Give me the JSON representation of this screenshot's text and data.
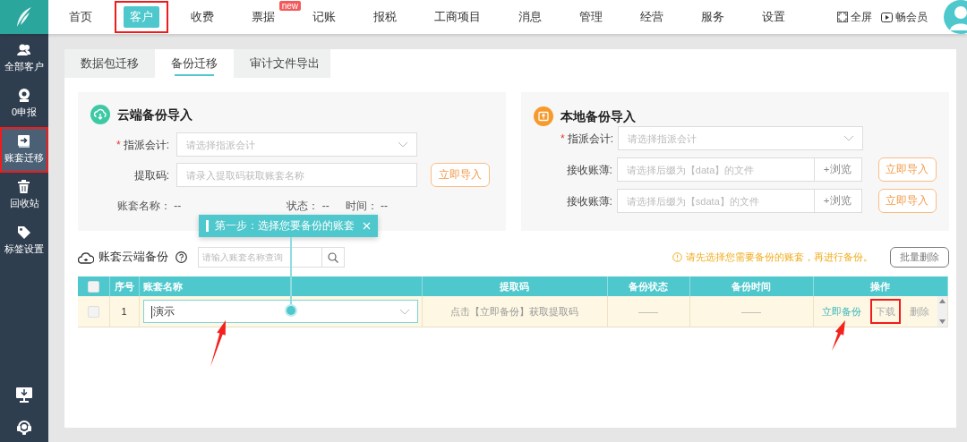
{
  "nav": [
    {
      "label": "首页",
      "selected": false,
      "annotated": false
    },
    {
      "label": "客户",
      "selected": true,
      "annotated": true
    },
    {
      "label": "收费",
      "selected": false,
      "annotated": false
    },
    {
      "label": "票据",
      "selected": false,
      "annotated": false,
      "badge": "new"
    },
    {
      "label": "记账",
      "selected": false,
      "annotated": false
    },
    {
      "label": "报税",
      "selected": false,
      "annotated": false
    },
    {
      "label": "工商项目",
      "selected": false,
      "annotated": false
    },
    {
      "label": "消息",
      "selected": false,
      "annotated": false
    },
    {
      "label": "管理",
      "selected": false,
      "annotated": false
    },
    {
      "label": "经营",
      "selected": false,
      "annotated": false
    },
    {
      "label": "服务",
      "selected": false,
      "annotated": false
    },
    {
      "label": "设置",
      "selected": false,
      "annotated": false
    }
  ],
  "header_actions": [
    {
      "kind": "fullscreen",
      "label": "全屏"
    },
    {
      "kind": "vip",
      "label": "畅会员"
    }
  ],
  "sidebar": {
    "items": [
      {
        "kind": "users",
        "label": "全部客户",
        "selected": false,
        "annotated": false
      },
      {
        "kind": "zero",
        "label": "0申报",
        "selected": false,
        "annotated": false
      },
      {
        "kind": "transfer",
        "label": "账套迁移",
        "selected": true,
        "annotated": true
      },
      {
        "kind": "trash",
        "label": "回收站",
        "selected": false,
        "annotated": false
      },
      {
        "kind": "tag",
        "label": "标签设置",
        "selected": false,
        "annotated": false
      }
    ]
  },
  "tabs": [
    {
      "label": "数据包迁移",
      "selected": false
    },
    {
      "label": "备份迁移",
      "selected": true
    },
    {
      "label": "审计文件导出",
      "selected": false
    }
  ],
  "cloud_import": {
    "title": "云端备份导入",
    "fields": [
      {
        "kind": "select",
        "label": "指派会计:",
        "required_mark": "*",
        "placeholder": "请选择指派会计"
      },
      {
        "kind": "input",
        "label": "提取码:",
        "placeholder": "请录入提取码获取账套名称",
        "button": "立即导入"
      }
    ],
    "info": [
      {
        "label": "账套名称：",
        "value": "--"
      },
      {
        "label": "状态：",
        "value": "--"
      },
      {
        "label": "时间：",
        "value": "--"
      }
    ]
  },
  "local_import": {
    "title": "本地备份导入",
    "fields": [
      {
        "kind": "select",
        "label": "指派会计:",
        "required_mark": "*",
        "placeholder": "请选择指派会计"
      },
      {
        "kind": "file",
        "label": "接收账薄:",
        "placeholder": "请选择后缀为【data】的文件",
        "browse": "+浏览",
        "button": "立即导入"
      },
      {
        "kind": "file",
        "label": "接收账薄:",
        "placeholder": "请选择后缀为【sdata】的文件",
        "browse": "+浏览",
        "button": "立即导入"
      }
    ]
  },
  "guide_tip": {
    "text": "第一步：选择您要备份的账套"
  },
  "backup_list": {
    "title": "账套云端备份",
    "search_placeholder": "请输入账套名称查询",
    "notice": "请先选择您需要备份的账套，再进行备份。",
    "bulk_button": {
      "label": "批量删除",
      "disabled": true
    },
    "table": {
      "columns": [
        {
          "kind": "checkbox",
          "checked": false
        },
        {
          "kind": "text",
          "label": "序号"
        },
        {
          "kind": "text",
          "label": "账套名称"
        },
        {
          "kind": "text",
          "label": "提取码"
        },
        {
          "kind": "text",
          "label": "备份状态"
        },
        {
          "kind": "text",
          "label": "备份时间"
        },
        {
          "kind": "text",
          "label": "操作"
        }
      ],
      "rows": [
        {
          "checked": false,
          "index": "1",
          "name": "演示",
          "code": "点击【立即备份】获取提取码",
          "status": "——",
          "time": "——",
          "actions": [
            {
              "label": "立即备份",
              "disabled": false,
              "annotated": false
            },
            {
              "label": "下载",
              "disabled": true,
              "annotated": true
            },
            {
              "label": "删除",
              "disabled": true,
              "annotated": false
            }
          ]
        }
      ]
    }
  }
}
